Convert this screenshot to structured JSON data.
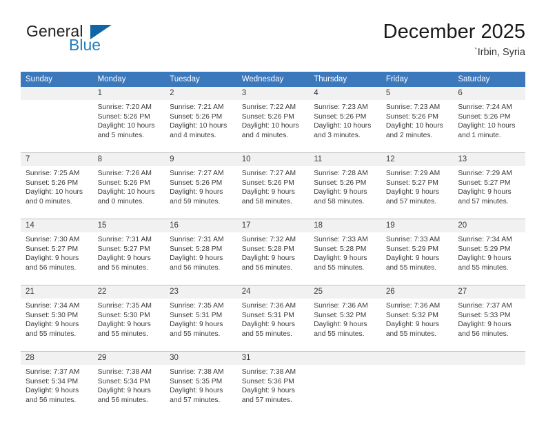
{
  "brand": {
    "name_top": "General",
    "name_bottom": "Blue",
    "accent_dark": "#1065a8",
    "accent_blue": "#1f7fc4"
  },
  "header": {
    "title": "December 2025",
    "subtitle": "`Irbin, Syria"
  },
  "theme": {
    "header_row_bg": "#3c78bc",
    "daynum_bg": "#f1f1f1",
    "grid_line": "#bfbfbf",
    "text": "#3a3a3a"
  },
  "columns": [
    "Sunday",
    "Monday",
    "Tuesday",
    "Wednesday",
    "Thursday",
    "Friday",
    "Saturday"
  ],
  "weeks": [
    [
      {
        "day": "",
        "empty": true,
        "sunrise": "",
        "sunset": "",
        "daylight": ""
      },
      {
        "day": "1",
        "sunrise": "Sunrise: 7:20 AM",
        "sunset": "Sunset: 5:26 PM",
        "daylight": "Daylight: 10 hours and 5 minutes."
      },
      {
        "day": "2",
        "sunrise": "Sunrise: 7:21 AM",
        "sunset": "Sunset: 5:26 PM",
        "daylight": "Daylight: 10 hours and 4 minutes."
      },
      {
        "day": "3",
        "sunrise": "Sunrise: 7:22 AM",
        "sunset": "Sunset: 5:26 PM",
        "daylight": "Daylight: 10 hours and 4 minutes."
      },
      {
        "day": "4",
        "sunrise": "Sunrise: 7:23 AM",
        "sunset": "Sunset: 5:26 PM",
        "daylight": "Daylight: 10 hours and 3 minutes."
      },
      {
        "day": "5",
        "sunrise": "Sunrise: 7:23 AM",
        "sunset": "Sunset: 5:26 PM",
        "daylight": "Daylight: 10 hours and 2 minutes."
      },
      {
        "day": "6",
        "sunrise": "Sunrise: 7:24 AM",
        "sunset": "Sunset: 5:26 PM",
        "daylight": "Daylight: 10 hours and 1 minute."
      }
    ],
    [
      {
        "day": "7",
        "sunrise": "Sunrise: 7:25 AM",
        "sunset": "Sunset: 5:26 PM",
        "daylight": "Daylight: 10 hours and 0 minutes."
      },
      {
        "day": "8",
        "sunrise": "Sunrise: 7:26 AM",
        "sunset": "Sunset: 5:26 PM",
        "daylight": "Daylight: 10 hours and 0 minutes."
      },
      {
        "day": "9",
        "sunrise": "Sunrise: 7:27 AM",
        "sunset": "Sunset: 5:26 PM",
        "daylight": "Daylight: 9 hours and 59 minutes."
      },
      {
        "day": "10",
        "sunrise": "Sunrise: 7:27 AM",
        "sunset": "Sunset: 5:26 PM",
        "daylight": "Daylight: 9 hours and 58 minutes."
      },
      {
        "day": "11",
        "sunrise": "Sunrise: 7:28 AM",
        "sunset": "Sunset: 5:26 PM",
        "daylight": "Daylight: 9 hours and 58 minutes."
      },
      {
        "day": "12",
        "sunrise": "Sunrise: 7:29 AM",
        "sunset": "Sunset: 5:27 PM",
        "daylight": "Daylight: 9 hours and 57 minutes."
      },
      {
        "day": "13",
        "sunrise": "Sunrise: 7:29 AM",
        "sunset": "Sunset: 5:27 PM",
        "daylight": "Daylight: 9 hours and 57 minutes."
      }
    ],
    [
      {
        "day": "14",
        "sunrise": "Sunrise: 7:30 AM",
        "sunset": "Sunset: 5:27 PM",
        "daylight": "Daylight: 9 hours and 56 minutes."
      },
      {
        "day": "15",
        "sunrise": "Sunrise: 7:31 AM",
        "sunset": "Sunset: 5:27 PM",
        "daylight": "Daylight: 9 hours and 56 minutes."
      },
      {
        "day": "16",
        "sunrise": "Sunrise: 7:31 AM",
        "sunset": "Sunset: 5:28 PM",
        "daylight": "Daylight: 9 hours and 56 minutes."
      },
      {
        "day": "17",
        "sunrise": "Sunrise: 7:32 AM",
        "sunset": "Sunset: 5:28 PM",
        "daylight": "Daylight: 9 hours and 56 minutes."
      },
      {
        "day": "18",
        "sunrise": "Sunrise: 7:33 AM",
        "sunset": "Sunset: 5:28 PM",
        "daylight": "Daylight: 9 hours and 55 minutes."
      },
      {
        "day": "19",
        "sunrise": "Sunrise: 7:33 AM",
        "sunset": "Sunset: 5:29 PM",
        "daylight": "Daylight: 9 hours and 55 minutes."
      },
      {
        "day": "20",
        "sunrise": "Sunrise: 7:34 AM",
        "sunset": "Sunset: 5:29 PM",
        "daylight": "Daylight: 9 hours and 55 minutes."
      }
    ],
    [
      {
        "day": "21",
        "sunrise": "Sunrise: 7:34 AM",
        "sunset": "Sunset: 5:30 PM",
        "daylight": "Daylight: 9 hours and 55 minutes."
      },
      {
        "day": "22",
        "sunrise": "Sunrise: 7:35 AM",
        "sunset": "Sunset: 5:30 PM",
        "daylight": "Daylight: 9 hours and 55 minutes."
      },
      {
        "day": "23",
        "sunrise": "Sunrise: 7:35 AM",
        "sunset": "Sunset: 5:31 PM",
        "daylight": "Daylight: 9 hours and 55 minutes."
      },
      {
        "day": "24",
        "sunrise": "Sunrise: 7:36 AM",
        "sunset": "Sunset: 5:31 PM",
        "daylight": "Daylight: 9 hours and 55 minutes."
      },
      {
        "day": "25",
        "sunrise": "Sunrise: 7:36 AM",
        "sunset": "Sunset: 5:32 PM",
        "daylight": "Daylight: 9 hours and 55 minutes."
      },
      {
        "day": "26",
        "sunrise": "Sunrise: 7:36 AM",
        "sunset": "Sunset: 5:32 PM",
        "daylight": "Daylight: 9 hours and 55 minutes."
      },
      {
        "day": "27",
        "sunrise": "Sunrise: 7:37 AM",
        "sunset": "Sunset: 5:33 PM",
        "daylight": "Daylight: 9 hours and 56 minutes."
      }
    ],
    [
      {
        "day": "28",
        "sunrise": "Sunrise: 7:37 AM",
        "sunset": "Sunset: 5:34 PM",
        "daylight": "Daylight: 9 hours and 56 minutes."
      },
      {
        "day": "29",
        "sunrise": "Sunrise: 7:38 AM",
        "sunset": "Sunset: 5:34 PM",
        "daylight": "Daylight: 9 hours and 56 minutes."
      },
      {
        "day": "30",
        "sunrise": "Sunrise: 7:38 AM",
        "sunset": "Sunset: 5:35 PM",
        "daylight": "Daylight: 9 hours and 57 minutes."
      },
      {
        "day": "31",
        "sunrise": "Sunrise: 7:38 AM",
        "sunset": "Sunset: 5:36 PM",
        "daylight": "Daylight: 9 hours and 57 minutes."
      },
      {
        "day": "",
        "empty": true,
        "sunrise": "",
        "sunset": "",
        "daylight": ""
      },
      {
        "day": "",
        "empty": true,
        "sunrise": "",
        "sunset": "",
        "daylight": ""
      },
      {
        "day": "",
        "empty": true,
        "sunrise": "",
        "sunset": "",
        "daylight": ""
      }
    ]
  ]
}
